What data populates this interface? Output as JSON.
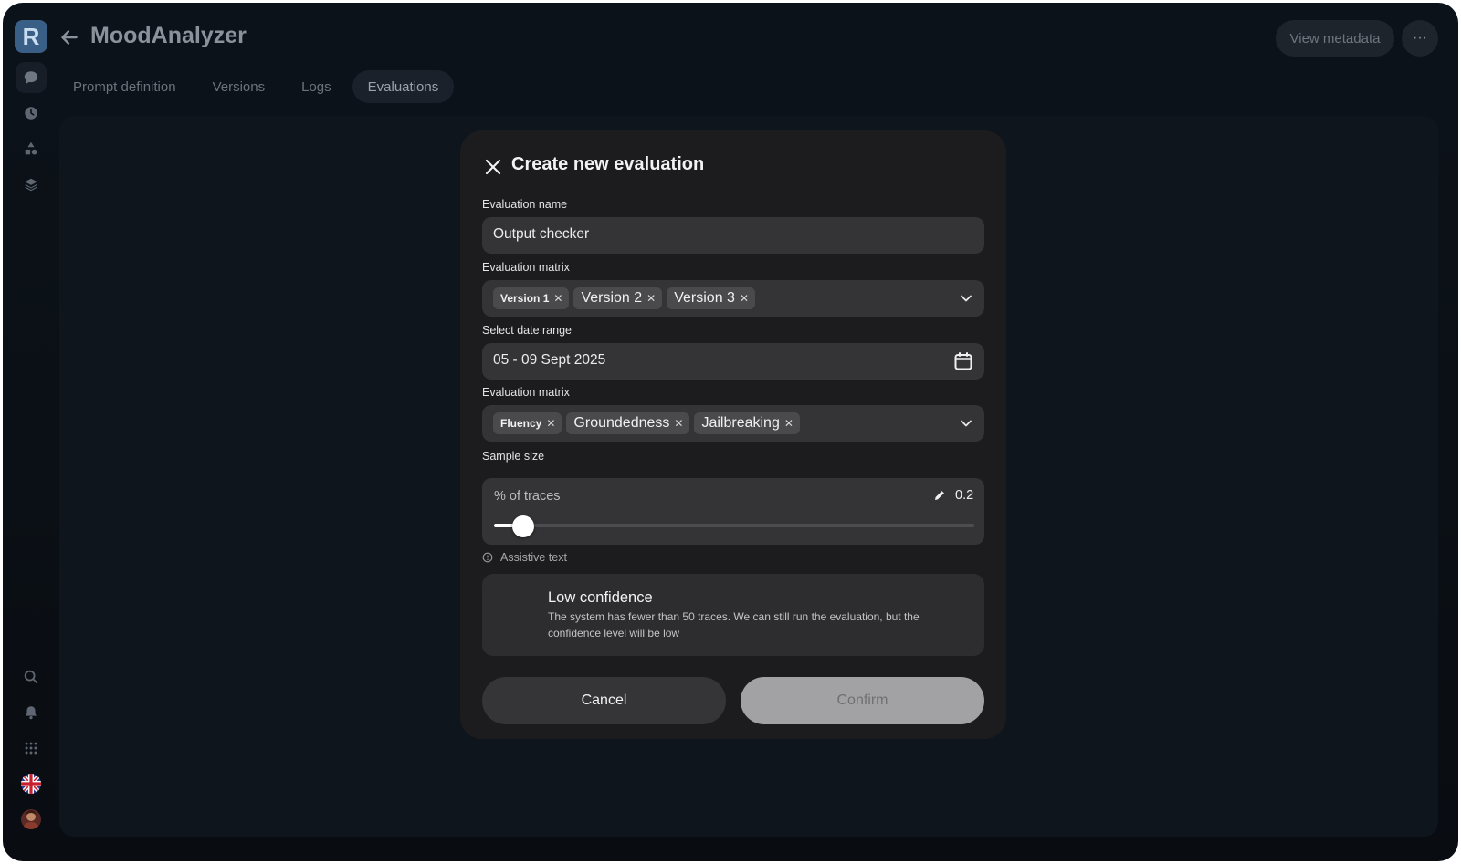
{
  "app": {
    "logo_letter": "R",
    "title": "MoodAnalyzer",
    "view_metadata_label": "View metadata",
    "more_label": "···"
  },
  "tabs": [
    {
      "label": "Prompt definition",
      "active": false
    },
    {
      "label": "Versions",
      "active": false
    },
    {
      "label": "Logs",
      "active": false
    },
    {
      "label": "Evaluations",
      "active": true
    }
  ],
  "sidebar": {
    "top_icons": [
      "chat-icon",
      "clock-icon",
      "shapes-icon",
      "layers-icon"
    ],
    "bottom_icons": [
      "search-icon",
      "bell-icon",
      "apps-grid-icon",
      "uk-flag-icon",
      "user-avatar"
    ]
  },
  "modal": {
    "title": "Create new evaluation",
    "name_label": "Evaluation name",
    "name_value": "Output checker",
    "versions_label": "Evaluation matrix",
    "versions": [
      "Version 1",
      "Version 2",
      "Version 3"
    ],
    "date_label": "Select date range",
    "date_value": "05 - 09 Sept 2025",
    "metrics_label": "Evaluation matrix",
    "metrics": [
      "Fluency",
      "Groundedness",
      "Jailbreaking"
    ],
    "sample_label": "Sample size",
    "sample_sublabel": "% of traces",
    "sample_value": "0.2",
    "sample_fraction": 0.06,
    "assistive_text": "Assistive text",
    "notice_title": "Low confidence",
    "notice_body": "The system has fewer than 50 traces. We can still run the evaluation, but the confidence level will be low",
    "cancel_label": "Cancel",
    "confirm_label": "Confirm"
  },
  "colors": {
    "background": "#0b1016",
    "modal": "#1c1c1e",
    "field": "#343436",
    "logo": "#3a5f86",
    "confirm_disabled": "#a2a2a4"
  }
}
